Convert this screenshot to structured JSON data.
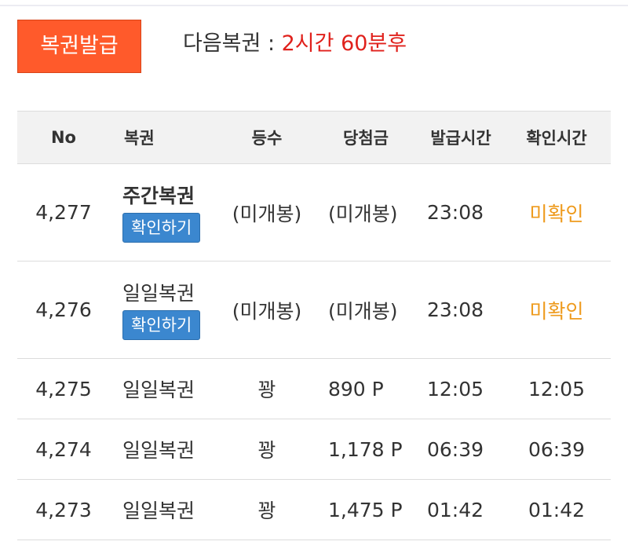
{
  "issue_button": "복권발급",
  "next_ticket": {
    "label": "다음복권 : ",
    "value": "2시간 60분후"
  },
  "table": {
    "headers": {
      "no": "No",
      "ticket": "복권",
      "rank": "등수",
      "prize": "당첨금",
      "issued": "발급시간",
      "checked": "확인시간"
    },
    "rows": [
      {
        "no": "4,277",
        "ticket": "주간복권",
        "check_button": "확인하기",
        "rank": "(미개봉)",
        "prize": "(미개봉)",
        "issued": "23:08",
        "checked": "미확인"
      },
      {
        "no": "4,276",
        "ticket": "일일복권",
        "check_button": "확인하기",
        "rank": "(미개봉)",
        "prize": "(미개봉)",
        "issued": "23:08",
        "checked": "미확인"
      },
      {
        "no": "4,275",
        "ticket": "일일복권",
        "rank": "꽝",
        "prize": "890 P",
        "issued": "12:05",
        "checked": "12:05"
      },
      {
        "no": "4,274",
        "ticket": "일일복권",
        "rank": "꽝",
        "prize": "1,178 P",
        "issued": "06:39",
        "checked": "06:39"
      },
      {
        "no": "4,273",
        "ticket": "일일복권",
        "rank": "꽝",
        "prize": "1,475 P",
        "issued": "01:42",
        "checked": "01:42"
      }
    ]
  },
  "colors": {
    "issue_button": "#ff5a2b",
    "next_value": "#e0211c",
    "check_button": "#3b87cf",
    "unconfirmed": "#ee9a1c"
  }
}
